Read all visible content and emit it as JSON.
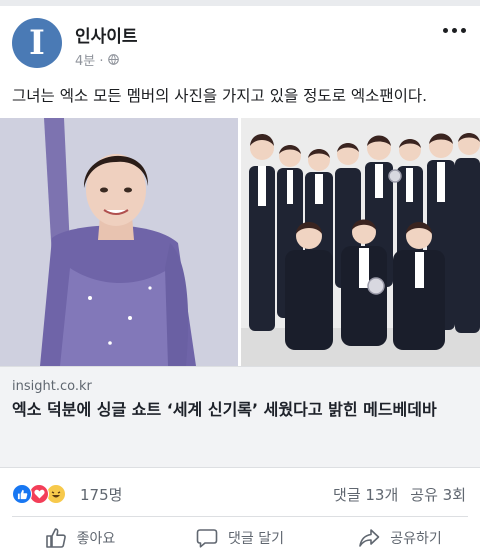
{
  "post": {
    "page_name": "인사이트",
    "avatar_letter": "I",
    "time": "4분 · ",
    "caption": "그녀는 엑소 모든 멤버의 사진을 가지고 있을 정도로 엑소팬이다."
  },
  "link": {
    "domain": "insight.co.kr",
    "title": "엑소 덕분에 싱글 쇼트 ‘세계 신기록’ 세웠다고 밝힌 메드베데바"
  },
  "reactions": {
    "count": "175명",
    "comments": "댓글 13개",
    "shares": "공유 3회"
  },
  "actions": {
    "like": "좋아요",
    "comment": "댓글 달기",
    "share": "공유하기"
  },
  "colors": {
    "accent": "#1877f2",
    "avatar": "#4a7ab5",
    "link_bg": "#f2f3f5",
    "muted": "#606770"
  },
  "icons": [
    "globe-icon",
    "more-icon",
    "like-reaction-icon",
    "love-reaction-icon",
    "haha-reaction-icon",
    "thumbs-up-icon",
    "comment-icon",
    "share-icon"
  ]
}
